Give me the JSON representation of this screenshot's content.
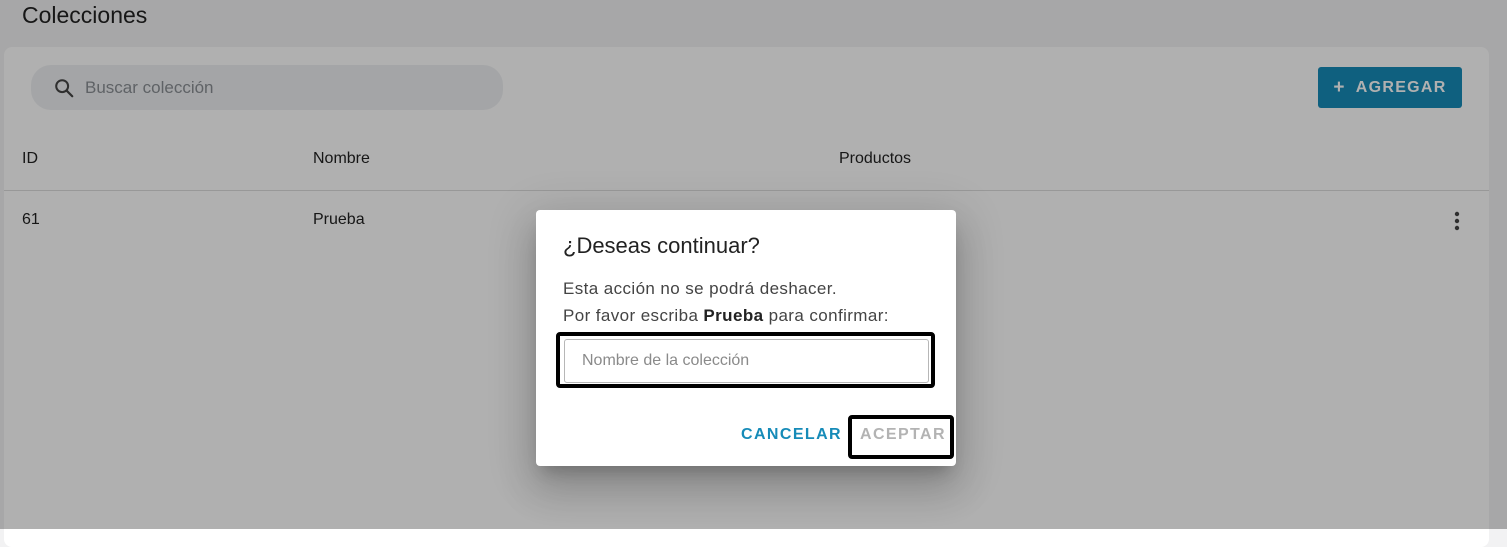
{
  "page": {
    "title": "Colecciones"
  },
  "toolbar": {
    "search_placeholder": "Buscar colección",
    "add_label": "AGREGAR",
    "add_icon": "plus-icon",
    "search_icon": "search-icon"
  },
  "table": {
    "columns": [
      "ID",
      "Nombre",
      "Productos"
    ],
    "rows": [
      {
        "id": "61",
        "nombre": "Prueba",
        "productos": ""
      }
    ]
  },
  "dialog": {
    "title": "¿Deseas continuar?",
    "message": "Esta acción no se podrá deshacer.",
    "confirm_prefix": "Por favor escriba",
    "confirm_word": "Prueba",
    "confirm_suffix": "para confirmar:",
    "input_placeholder": "Nombre de la colección",
    "input_value": "",
    "cancel_label": "CANCELAR",
    "accept_label": "ACEPTAR"
  },
  "colors": {
    "accent": "#168bb8",
    "disabled": "#b3b3b3",
    "overlay": "rgba(0,0,0,0.31)"
  }
}
